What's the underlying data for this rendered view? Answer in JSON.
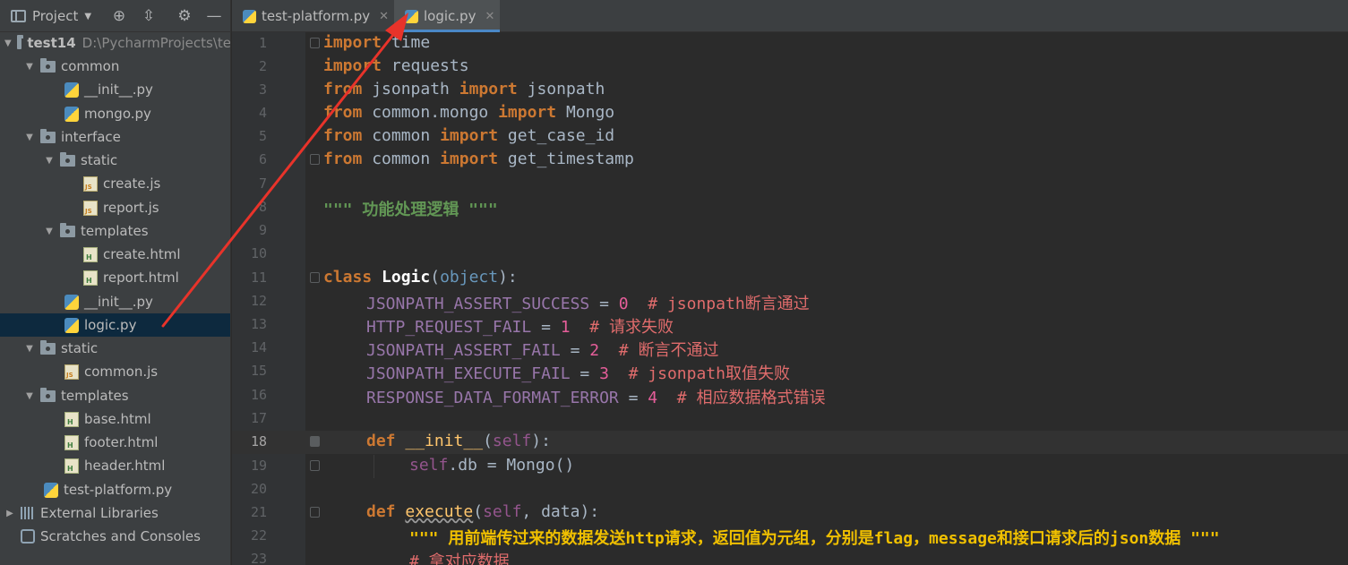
{
  "sidebar": {
    "title": "Project",
    "root": {
      "name": "test14",
      "path": "D:\\PycharmProjects\\te"
    },
    "items": [
      {
        "label": "common"
      },
      {
        "label": "__init__.py"
      },
      {
        "label": "mongo.py"
      },
      {
        "label": "interface"
      },
      {
        "label": "static"
      },
      {
        "label": "create.js"
      },
      {
        "label": "report.js"
      },
      {
        "label": "templates"
      },
      {
        "label": "create.html"
      },
      {
        "label": "report.html"
      },
      {
        "label": "__init__.py"
      },
      {
        "label": "logic.py"
      },
      {
        "label": "static"
      },
      {
        "label": "common.js"
      },
      {
        "label": "templates"
      },
      {
        "label": "base.html"
      },
      {
        "label": "footer.html"
      },
      {
        "label": "header.html"
      },
      {
        "label": "test-platform.py"
      },
      {
        "label": "External Libraries"
      },
      {
        "label": "Scratches and Consoles"
      }
    ],
    "selected_item": "logic.py"
  },
  "tabs": [
    {
      "label": "test-platform.py",
      "active": false
    },
    {
      "label": "logic.py",
      "active": true
    }
  ],
  "editor": {
    "current_line": 18,
    "line_numbers": [
      "1",
      "2",
      "3",
      "4",
      "5",
      "6",
      "7",
      "8",
      "9",
      "10",
      "11",
      "12",
      "13",
      "14",
      "15",
      "16",
      "17",
      "18",
      "19",
      "20",
      "21",
      "22",
      "23"
    ],
    "code": {
      "l1": [
        "import",
        " time"
      ],
      "l2": [
        "import",
        " requests"
      ],
      "l3": [
        "from",
        " jsonpath ",
        "import",
        " jsonpath"
      ],
      "l4": [
        "from",
        " common.mongo ",
        "import",
        " Mongo"
      ],
      "l5": [
        "from",
        " common ",
        "import",
        " get_case_id"
      ],
      "l6": [
        "from",
        " common ",
        "import",
        " get_timestamp"
      ],
      "l8": "\"\"\" 功能处理逻辑 \"\"\"",
      "l11": [
        "class",
        " ",
        "Logic",
        "(",
        "object",
        "):"
      ],
      "l12": [
        "JSONPATH_ASSERT_SUCCESS",
        " = ",
        "0",
        "  # jsonpath断言通过"
      ],
      "l13": [
        "HTTP_REQUEST_FAIL",
        " = ",
        "1",
        "  # 请求失败"
      ],
      "l14": [
        "JSONPATH_ASSERT_FAIL",
        " = ",
        "2",
        "  # 断言不通过"
      ],
      "l15": [
        "JSONPATH_EXECUTE_FAIL",
        " = ",
        "3",
        "  # jsonpath取值失败"
      ],
      "l16": [
        "RESPONSE_DATA_FORMAT_ERROR",
        " = ",
        "4",
        "  # 相应数据格式错误"
      ],
      "l18": [
        "def",
        " ",
        "__init__",
        "(",
        "self",
        "):"
      ],
      "l19": [
        "self",
        ".db = Mongo()"
      ],
      "l21": [
        "def",
        " ",
        "execute",
        "(",
        "self",
        ", data):"
      ],
      "l22": "\"\"\" 用前端传过来的数据发送http请求，返回值为元组，分别是flag，message和接口请求后的json数据 \"\"\"",
      "l23": "# 拿对应数据"
    }
  },
  "colors": {
    "keyword": "#cc7832",
    "docstring": "#629755",
    "number": "#e65e9a",
    "comment": "#e06c6c",
    "annotation_arrow": "#e8332a"
  }
}
